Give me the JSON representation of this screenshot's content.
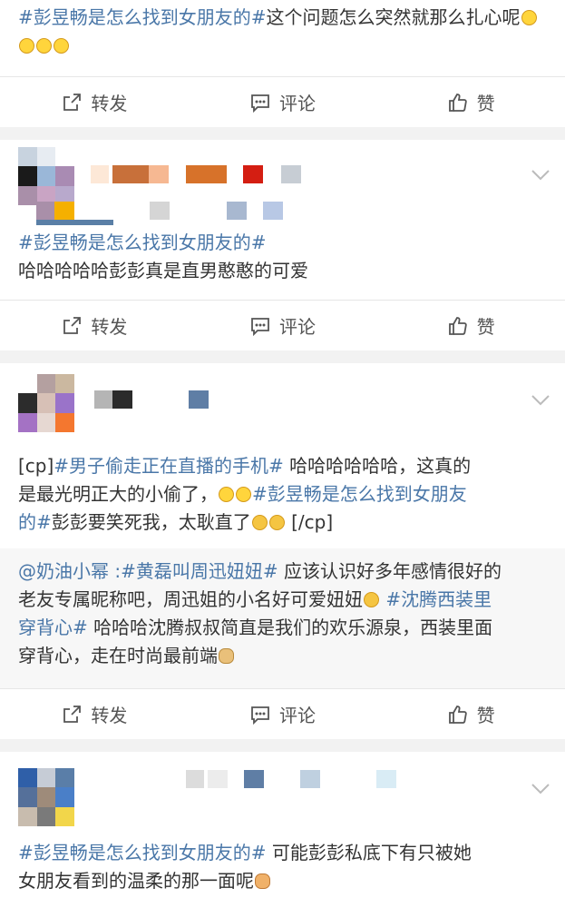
{
  "posts": [
    {
      "text_tag": "#彭昱畅是怎么找到女朋友的#",
      "text_rest": "这个问题怎么突然就那么扎心呢",
      "actions": {
        "repost": "转发",
        "comment": "评论",
        "like": "赞"
      }
    },
    {
      "text_tag": "#彭昱畅是怎么找到女朋友的#",
      "text_body": "哈哈哈哈哈彭彭真是直男憨憨的可爱",
      "actions": {
        "repost": "转发",
        "comment": "评论",
        "like": "赞"
      }
    },
    {
      "line1_a": "[cp]",
      "line1_tag": "#男子偷走正在直播的手机#",
      "line1_b": " 哈哈哈哈哈哈，这真的",
      "line2_a": "是最光明正大的小偷了，",
      "line2_tag": "#彭昱畅是怎么找到女朋友",
      "line3_tag": "的#",
      "line3_b": "彭彭要笑死我，太耿直了",
      "line3_c": " [/cp]",
      "retweet": {
        "user": "@奶油小幂",
        "sep": " :",
        "tag1": "#黄磊叫周迅妞妞#",
        "t1": " 应该认识好多年感情很好的",
        "t2": "老友专属昵称吧，周迅姐的小名好可爱妞妞",
        "tag2a": " #沈腾西装里",
        "tag2b": "穿背心#",
        "t3": " 哈哈哈沈腾叔叔简直是我们的欢乐源泉，西装里面",
        "t4": "穿背心，走在时尚最前端"
      },
      "actions": {
        "repost": "转发",
        "comment": "评论",
        "like": "赞"
      }
    },
    {
      "text_tag": "#彭昱畅是怎么找到女朋友的#",
      "text_rest": " 可能彭彭私底下有只被她",
      "text_line2": "女朋友看到的温柔的那一面呢"
    }
  ],
  "icons": [
    "repost-icon",
    "comment-icon",
    "like-icon",
    "chevron-down-icon"
  ],
  "colors": {
    "tag": "#4a77a8",
    "text": "#333333",
    "bg": "#f2f2f2"
  }
}
